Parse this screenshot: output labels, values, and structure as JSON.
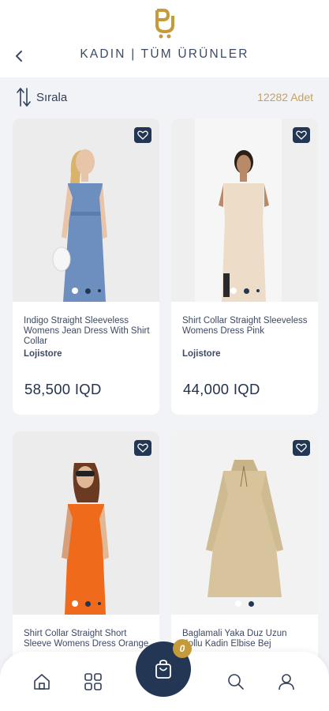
{
  "header": {
    "title": "KADIN | TÜM ÜRÜNLER",
    "logo_icon": "store-bag-logo",
    "back_icon": "chevron-left-icon"
  },
  "toolbar": {
    "sort_label": "Sırala",
    "sort_icon": "sort-arrows-icon",
    "count_label": "12282 Adet"
  },
  "products": [
    {
      "name": "Indigo Straight Sleeveless Womens Jean Dress With Shirt Collar",
      "seller": "Lojistore",
      "price": "58,500 IQD"
    },
    {
      "name": "Shirt Collar Straight Sleeveless Womens Dress Pink",
      "seller": "Lojistore",
      "price": "44,000 IQD"
    },
    {
      "name": "Shirt Collar Straight Short Sleeve Womens Dress Orange",
      "seller": "",
      "price": ""
    },
    {
      "name": "Baglamali Yaka Duz Uzun Kollu Kadin Elbise Bej",
      "seller": "",
      "price": ""
    }
  ],
  "bottom_nav": {
    "home_icon": "home-icon",
    "categories_icon": "grid-icon",
    "cart_icon": "shopping-bag-icon",
    "cart_count": "0",
    "search_icon": "search-icon",
    "profile_icon": "user-icon"
  },
  "colors": {
    "primary": "#233653",
    "accent": "#c9a15a",
    "background": "#f1f3f6"
  }
}
